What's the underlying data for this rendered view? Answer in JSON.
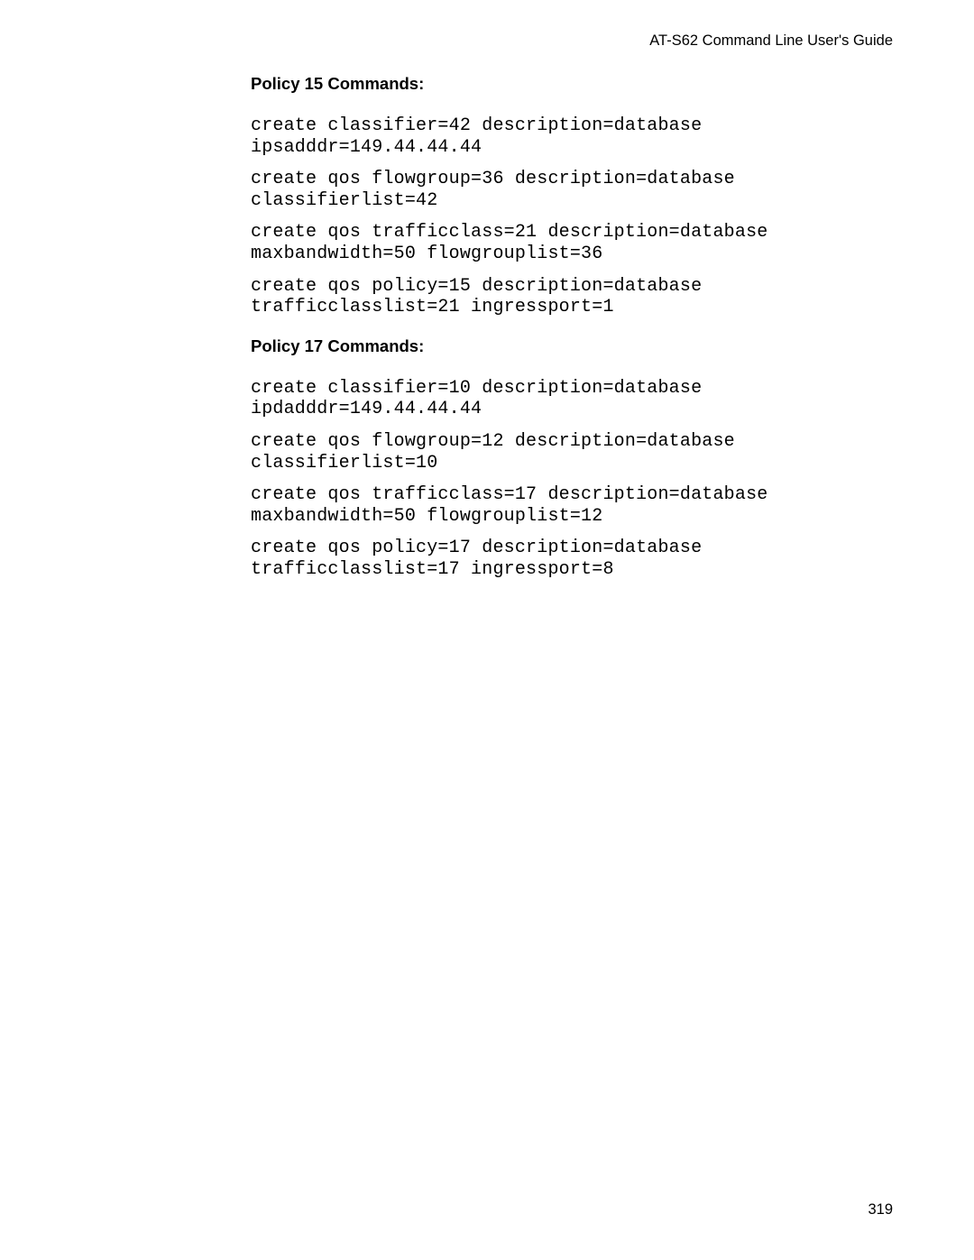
{
  "header": {
    "guide_title": "AT-S62 Command Line User's Guide"
  },
  "sections": [
    {
      "heading": "Policy 15 Commands:",
      "commands": [
        "create classifier=42 description=database\nipsadddr=149.44.44.44",
        "create qos flowgroup=36 description=database\nclassifierlist=42",
        "create qos trafficclass=21 description=database\nmaxbandwidth=50 flowgrouplist=36",
        "create qos policy=15 description=database\ntrafficclasslist=21 ingressport=1"
      ]
    },
    {
      "heading": "Policy 17 Commands:",
      "commands": [
        "create classifier=10 description=database\nipdadddr=149.44.44.44",
        "create qos flowgroup=12 description=database\nclassifierlist=10",
        "create qos trafficclass=17 description=database\nmaxbandwidth=50 flowgrouplist=12",
        "create qos policy=17 description=database\ntrafficclasslist=17 ingressport=8"
      ]
    }
  ],
  "footer": {
    "page_number": "319"
  }
}
